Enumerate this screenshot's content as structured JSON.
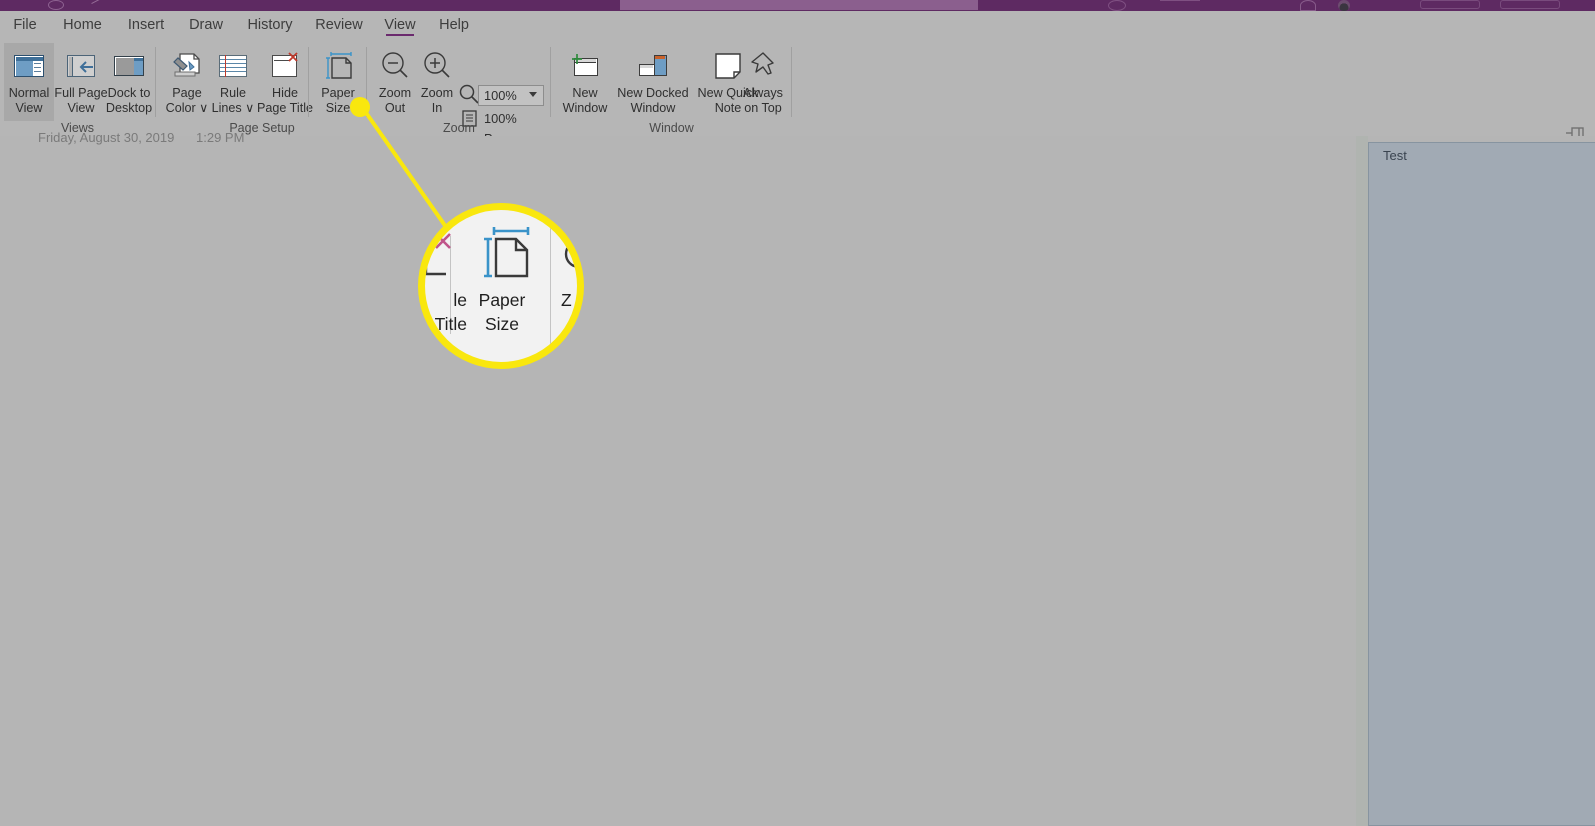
{
  "app": {
    "title_bar": {
      "search_placeholder": "",
      "icons": [
        "back-icon",
        "forward-icon",
        "undo-icon",
        "redo-icon",
        "share-icon",
        "account-avatar",
        "window-controls"
      ]
    }
  },
  "ribbon": {
    "tabs": [
      {
        "label": "File",
        "active": false
      },
      {
        "label": "Home",
        "active": false
      },
      {
        "label": "Insert",
        "active": false
      },
      {
        "label": "Draw",
        "active": false
      },
      {
        "label": "History",
        "active": false
      },
      {
        "label": "Review",
        "active": false
      },
      {
        "label": "View",
        "active": true
      },
      {
        "label": "Help",
        "active": false
      }
    ],
    "groups": [
      {
        "name": "Views",
        "label": "Views",
        "buttons": [
          {
            "label_top": "Normal",
            "label_bottom": "View",
            "icon": "normal-view-icon",
            "selected": true
          },
          {
            "label_top": "Full Page",
            "label_bottom": "View",
            "icon": "full-page-view-icon",
            "selected": false
          },
          {
            "label_top": "Dock to",
            "label_bottom": "Desktop",
            "icon": "dock-to-desktop-icon",
            "selected": false
          }
        ]
      },
      {
        "name": "Page Setup",
        "label": "Page Setup",
        "buttons": [
          {
            "label_top": "Page",
            "label_bottom": "Color ∨",
            "icon": "page-color-icon",
            "selected": false
          },
          {
            "label_top": "Rule",
            "label_bottom": "Lines ∨",
            "icon": "rule-lines-icon",
            "selected": false
          },
          {
            "label_top": "Hide",
            "label_bottom": "Page Title",
            "icon": "hide-page-title-icon",
            "selected": false
          },
          {
            "label_top": "Paper",
            "label_bottom": "Size",
            "icon": "paper-size-icon",
            "selected": false
          }
        ]
      },
      {
        "name": "Zoom",
        "label": "Zoom",
        "buttons": [
          {
            "label_top": "Zoom",
            "label_bottom": "Out",
            "icon": "zoom-out-icon",
            "selected": false
          },
          {
            "label_top": "Zoom",
            "label_bottom": "In",
            "icon": "zoom-in-icon",
            "selected": false
          }
        ],
        "zoom_select_value": "100%",
        "zoom_100_label": "100%",
        "page_width_label": "Page Width"
      },
      {
        "name": "Window",
        "label": "Window",
        "buttons": [
          {
            "label_top": "New",
            "label_bottom": "Window",
            "icon": "new-window-icon",
            "selected": false
          },
          {
            "label_top": "New Docked",
            "label_bottom": "Window",
            "icon": "new-docked-window-icon",
            "selected": false
          },
          {
            "label_top": "New Quick",
            "label_bottom": "Note",
            "icon": "new-quick-note-icon",
            "selected": false
          },
          {
            "label_top": "Always",
            "label_bottom": "on Top",
            "icon": "always-on-top-icon",
            "selected": false
          }
        ]
      }
    ],
    "pin_icon": "pin-ribbon-icon"
  },
  "document": {
    "date": "Friday, August 30, 2019",
    "time": "1:29 PM"
  },
  "side_panel": {
    "title": "Test"
  },
  "callout": {
    "target_label_top": "Paper",
    "target_label_bottom": "Size",
    "neighbor_left_top": "le",
    "neighbor_left_bottom": "Title",
    "neighbor_right": "Z",
    "highlight_color": "#f9e70e"
  }
}
